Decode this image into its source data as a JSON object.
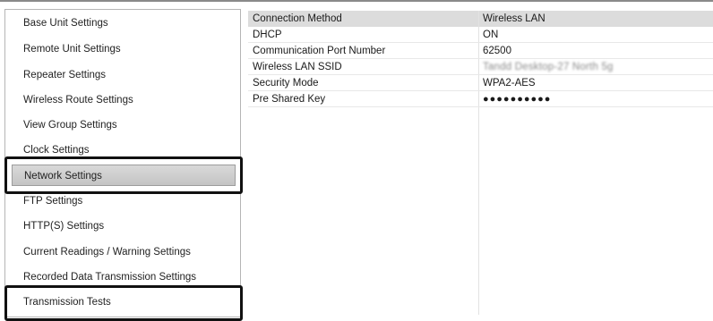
{
  "sidebar": {
    "items": [
      {
        "label": "Base Unit Settings"
      },
      {
        "label": "Remote Unit Settings"
      },
      {
        "label": "Repeater Settings"
      },
      {
        "label": "Wireless Route Settings"
      },
      {
        "label": "View Group Settings"
      },
      {
        "label": "Clock Settings"
      },
      {
        "label": "Network Settings",
        "selected": true
      },
      {
        "label": "FTP Settings"
      },
      {
        "label": "HTTP(S) Settings"
      },
      {
        "label": "Current Readings / Warning Settings"
      },
      {
        "label": "Recorded Data Transmission Settings"
      },
      {
        "label": "Transmission Tests"
      }
    ]
  },
  "properties": {
    "rows": [
      {
        "name": "Connection Method",
        "value": "Wireless LAN"
      },
      {
        "name": "DHCP",
        "value": "ON"
      },
      {
        "name": "Communication Port Number",
        "value": "62500"
      },
      {
        "name": "Wireless LAN SSID",
        "value": "Tandd Desktop-27 North 5g"
      },
      {
        "name": "Security Mode",
        "value": "WPA2-AES"
      },
      {
        "name": "Pre Shared Key",
        "value": "●●●●●●●●●●"
      }
    ]
  },
  "colors": {
    "selected_bg": "#c8c8c8",
    "header_bg": "#dcdcdc",
    "callout_border": "#111111"
  }
}
